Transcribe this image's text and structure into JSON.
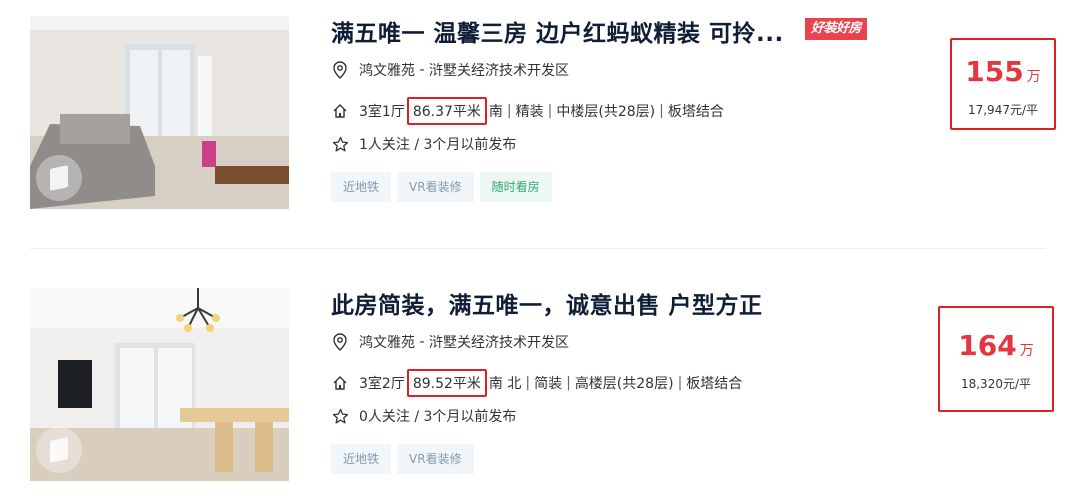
{
  "colors": {
    "price": "#e5363f",
    "highlight_border": "#e02020",
    "title": "#101d37",
    "tag_text": "#849aae",
    "tag_green": "#33a47a"
  },
  "listings": [
    {
      "title": "满五唯一 温馨三房 边户红蚂蚁精装 可拎...",
      "badge": "好装好房",
      "community": "鸿文雅苑",
      "location_sep": " - ",
      "district": "浒墅关经济技术开发区",
      "layout": "3室1厅",
      "area": "86.37平米",
      "details": [
        "南",
        "精装",
        "中楼层(共28层)",
        "板塔结合"
      ],
      "follow": "1人关注 / 3个月以前发布",
      "tags": [
        "近地铁",
        "VR看装修",
        "随时看房"
      ],
      "price": "155",
      "price_unit": "万",
      "unit_price": "17,947元/平"
    },
    {
      "title": "此房简装，满五唯一，诚意出售 户型方正",
      "community": "鸿文雅苑",
      "location_sep": " - ",
      "district": "浒墅关经济技术开发区",
      "layout": "3室2厅",
      "area": "89.52平米",
      "details": [
        "南 北",
        "简装",
        "高楼层(共28层)",
        "板塔结合"
      ],
      "follow": "0人关注 / 3个月以前发布",
      "tags": [
        "近地铁",
        "VR看装修"
      ],
      "price": "164",
      "price_unit": "万",
      "unit_price": "18,320元/平"
    }
  ],
  "separator": "|",
  "icons": {
    "location": "location-pin-icon",
    "house": "house-icon",
    "follow": "star-icon",
    "vr": "vr-cube-icon"
  }
}
